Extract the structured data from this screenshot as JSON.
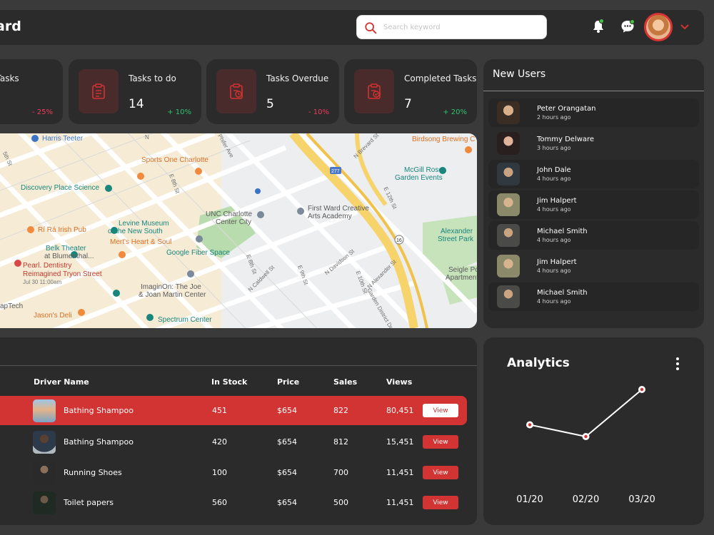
{
  "header": {
    "title": "ard",
    "search_placeholder": "Search keyword"
  },
  "stats": [
    {
      "label": "al Tasks",
      "value": "",
      "delta": "- 25%"
    },
    {
      "label": "Tasks to do",
      "value": "14",
      "delta": "+ 10%"
    },
    {
      "label": "Tasks Overdue",
      "value": "5",
      "delta": "- 10%"
    },
    {
      "label": "Completed Tasks",
      "value": "7",
      "delta": "+ 20%"
    }
  ],
  "map": {
    "places": {
      "harris": "Harris Teeter",
      "sports_one": "Sports One Charlotte",
      "birdsong": "Birdsong Brewing C",
      "mcgill1": "McGill Rose",
      "mcgill2": "Garden Events",
      "discovery": "Discovery Place Science",
      "levine1": "Levine Museum",
      "levine2": "of the New South",
      "ri_ra": "Rí Rá Irish Pub",
      "merts": "Mert's Heart & Soul",
      "unc1": "UNC Charlotte",
      "unc2": "Center City",
      "firstward1": "First Ward Creative",
      "firstward2": "Arts Academy",
      "alexander1": "Alexander",
      "alexander2": "Street Park",
      "belk1": "Belk Theater",
      "belk2": "at Blumenthal...",
      "pearl1": "Pearl. Dentistry",
      "pearl2": "Reimagined Tryon Street",
      "pearl_time": "Jul 30 11:00am",
      "google_fiber": "Google Fiber Space",
      "imaginon1": "ImaginOn: The Joe",
      "imaginon2": "& Joan Martin Center",
      "aptech": "apTech",
      "jasons": "Jason's Deli",
      "spectrum": "Spectrum Center",
      "seigle1": "Seigle Po",
      "seigle2": "Apartment Hon",
      "road_5th": "5th St",
      "road_n": "N",
      "road_phifer": "Phifer Ave",
      "road_brevard": "N Brevard St",
      "road_8th": "E 8th St",
      "road_12th": "E 12th St",
      "road_caldwell": "N Caldwell St",
      "road_davidson": "N Davidson St",
      "road_e8th": "E 8th St",
      "road_9th": "E 9th St",
      "road_10th": "E 10th St",
      "road_alexander": "N Alexander St",
      "road_garden": "Garden District Dr",
      "route_277": "277",
      "route_16": "16"
    }
  },
  "new_users": {
    "title": "New Users",
    "items": [
      {
        "name": "Peter Orangatan",
        "time": "2 hours ago"
      },
      {
        "name": "Tommy Delware",
        "time": "3 hours ago"
      },
      {
        "name": "John Dale",
        "time": "4 hours ago"
      },
      {
        "name": "Jim Halpert",
        "time": "4 hours ago"
      },
      {
        "name": "Michael Smith",
        "time": "4 hours ago"
      },
      {
        "name": "Jim Halpert",
        "time": "4 hours ago"
      },
      {
        "name": "Michael Smith",
        "time": "4 hours ago"
      }
    ]
  },
  "table": {
    "headers": {
      "driver": "Driver Name",
      "stock": "In Stock",
      "price": "Price",
      "sales": "Sales",
      "views": "Views"
    },
    "rows": [
      {
        "name": "Bathing Shampoo",
        "stock": "451",
        "price": "$654",
        "sales": "822",
        "views": "80,451",
        "action": "View"
      },
      {
        "name": "Bathing Shampoo",
        "stock": "420",
        "price": "$654",
        "sales": "812",
        "views": "15,451",
        "action": "View"
      },
      {
        "name": "Running Shoes",
        "stock": "100",
        "price": "$654",
        "sales": "700",
        "views": "11,451",
        "action": "View"
      },
      {
        "name": "Toilet papers",
        "stock": "560",
        "price": "$654",
        "sales": "500",
        "views": "11,451",
        "action": "View"
      }
    ]
  },
  "analytics": {
    "title": "Analytics"
  },
  "chart_data": {
    "type": "line",
    "categories": [
      "01/20",
      "02/20",
      "03/20"
    ],
    "series": [
      {
        "values": [
          5,
          4,
          8
        ]
      }
    ],
    "title": "Analytics",
    "xlabel": "",
    "ylabel": "",
    "ylim": [
      0,
      10
    ],
    "grid": false,
    "colors": {
      "line": "#ffffff",
      "marker_fill": "#ffffff",
      "marker_dot": "#d23333"
    }
  },
  "colors": {
    "background": "#3a3a3a",
    "panel": "#2b2b2b",
    "accent": "#d23333",
    "positive": "#2fc26e",
    "negative": "#ef3b5a",
    "notification_dot": "#3fc53f"
  }
}
